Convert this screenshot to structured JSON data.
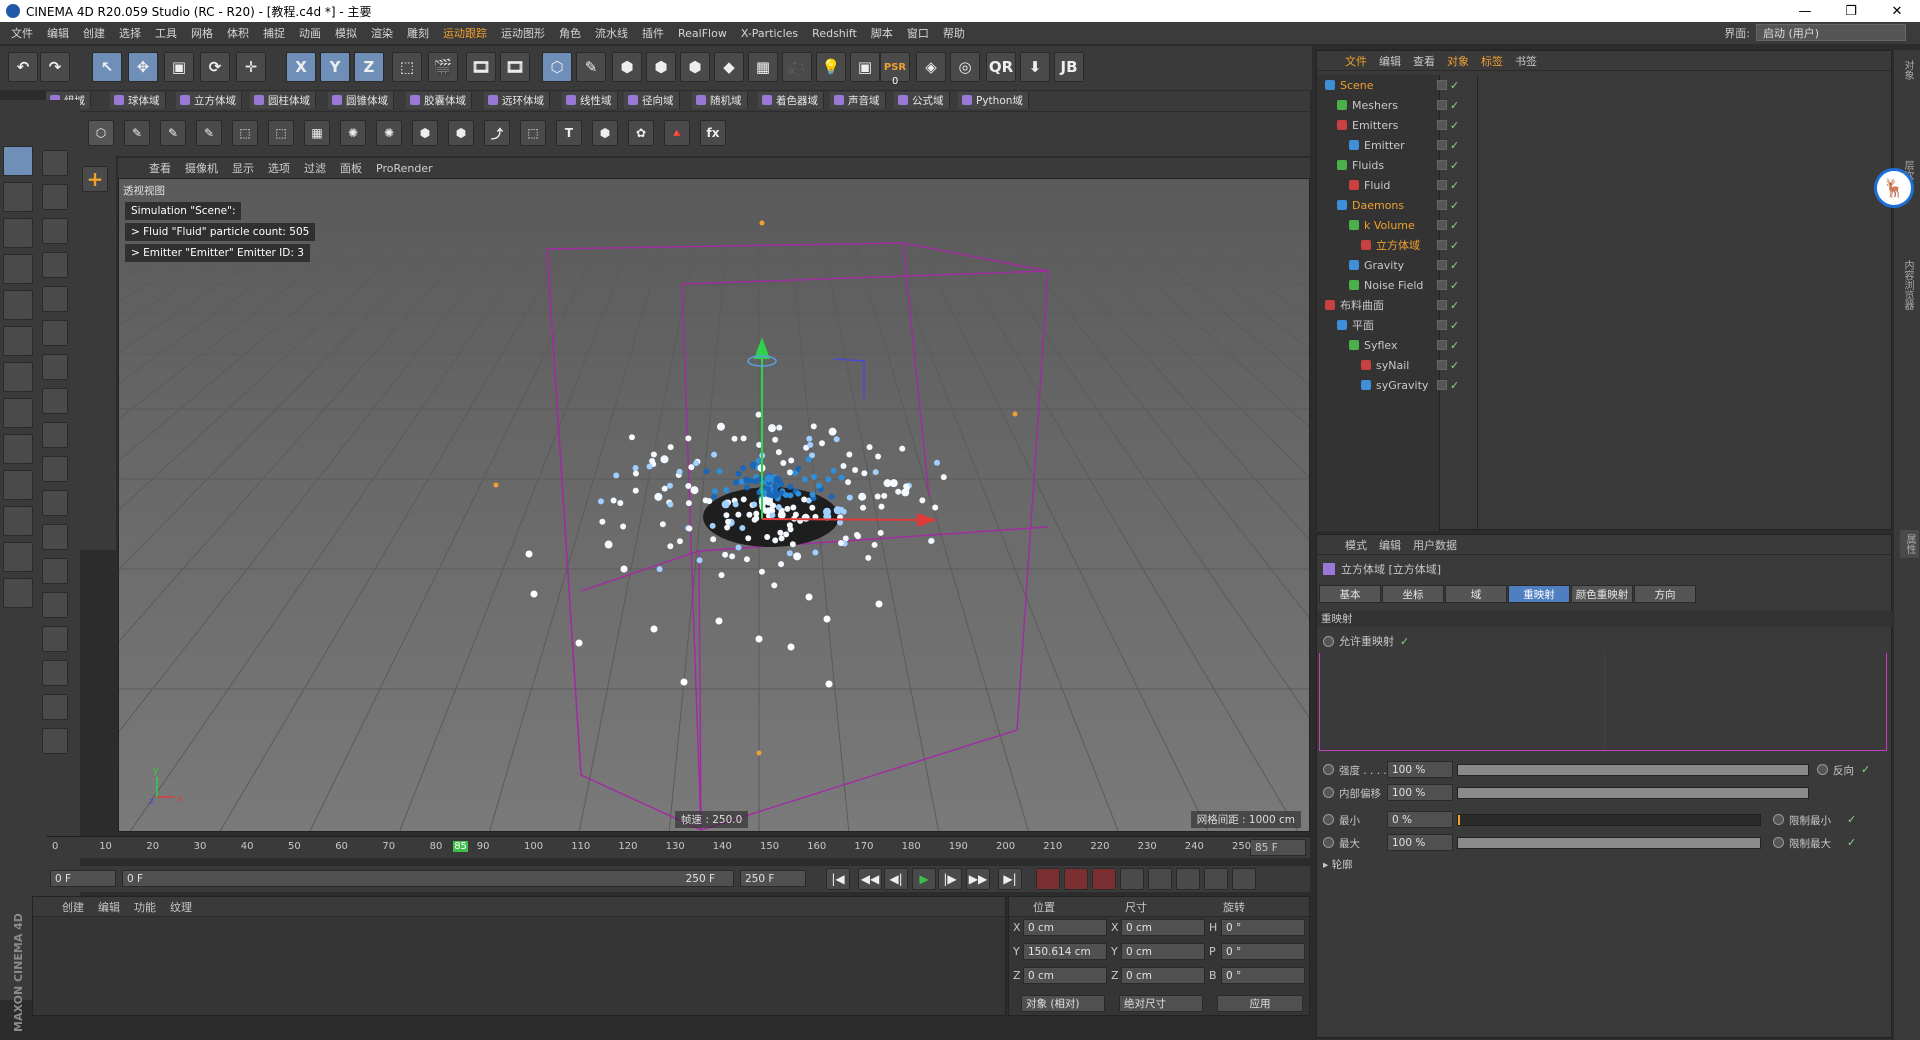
{
  "title": "CINEMA 4D R20.059 Studio (RC - R20) - [教程.c4d *] - 主要",
  "window_controls": [
    "—",
    "❐",
    "✕"
  ],
  "menu": [
    "文件",
    "编辑",
    "创建",
    "选择",
    "工具",
    "网格",
    "体积",
    "捕捉",
    "动画",
    "模拟",
    "渲染",
    "雕刻",
    "运动跟踪",
    "运动图形",
    "角色",
    "流水线",
    "插件",
    "RealFlow",
    "X-Particles",
    "Redshift",
    "脚本",
    "窗口",
    "帮助"
  ],
  "layout_label": "界面:",
  "layout_value": "启动 (用户)",
  "toolbar_main": [
    "↶",
    "↷",
    "↖",
    "✥",
    "▣",
    "⟳",
    "✛",
    "X",
    "Y",
    "Z",
    "⬚",
    "🎬",
    "🎞",
    "🎞",
    "⬡",
    "✎",
    "⬢",
    "⬢",
    "⬢",
    "◆",
    "▦",
    "🎥",
    "💡",
    "▣",
    "PSR",
    "◈",
    "◎",
    "QR",
    "⬇",
    "JB"
  ],
  "toolbar_main_icons": [
    "undo-icon",
    "redo-icon",
    "select-icon",
    "move-icon",
    "scale-icon",
    "rotate-icon",
    "transform-icon",
    "x-axis-icon",
    "y-axis-icon",
    "z-axis-icon",
    "coord-icon",
    "render-view-icon",
    "render-icon",
    "render-settings-icon",
    "cube-icon",
    "pen-icon",
    "subdivide-icon",
    "array-icon",
    "deformer-icon",
    "field-icon",
    "floor-icon",
    "camera-icon",
    "light-icon",
    "tag-icon",
    "psr-icon",
    "xpresso-icon",
    "sphere-icon",
    "qr-icon",
    "drop-icon",
    "jb-icon"
  ],
  "psr_value": "0",
  "fields_bar": [
    "组域",
    "球体域",
    "立方体域",
    "圆柱体域",
    "圆锥体域",
    "胶囊体域",
    "远环体域",
    "线性域",
    "径向域",
    "随机域",
    "着色器域",
    "声音域",
    "公式域",
    "Python域"
  ],
  "toolbar_second": [
    "▦",
    "⬡",
    "✎",
    "✎",
    "✎",
    "⬚",
    "⬚",
    "▦",
    "✺",
    "✺",
    "⬢",
    "⬢",
    "⤴",
    "⬚",
    "T",
    "⬢",
    "✿",
    "🔺",
    "fx"
  ],
  "viewport_menu": [
    "查看",
    "摄像机",
    "显示",
    "选项",
    "过滤",
    "面板",
    "ProRender"
  ],
  "viewport_label": "透视视图",
  "hud": [
    "Simulation \"Scene\":",
    "  > Fluid \"Fluid\" particle count: 505",
    "  > Emitter \"Emitter\" Emitter ID: 3"
  ],
  "fps": "帧速 : 250.0",
  "grid_spacing": "网格间距 : 1000 cm",
  "timeline_ticks": [
    "0",
    "10",
    "20",
    "30",
    "40",
    "50",
    "60",
    "70",
    "80",
    "85",
    "90",
    "100",
    "110",
    "120",
    "130",
    "140",
    "150",
    "160",
    "170",
    "180",
    "190",
    "200",
    "210",
    "220",
    "230",
    "240",
    "250"
  ],
  "current_frame": "85 F",
  "timeline_start": "0 F",
  "timeline_range_start": "0 F",
  "timeline_range_end": "250 F",
  "timeline_end": "250 F",
  "playback": [
    "|◀",
    "◀◀",
    "◀|",
    "▶",
    "|▶",
    "▶▶",
    "▶|"
  ],
  "material_menu": [
    "创建",
    "编辑",
    "功能",
    "纹理"
  ],
  "brand": "MAXON CINEMA 4D",
  "coord_headers": [
    "位置",
    "尺寸",
    "旋转"
  ],
  "coords": [
    {
      "axis": "X",
      "pos": "0 cm",
      "size_axis": "X",
      "size": "0 cm",
      "rot_axis": "H",
      "rot": "0 °"
    },
    {
      "axis": "Y",
      "pos": "150.614 cm",
      "size_axis": "Y",
      "size": "0 cm",
      "rot_axis": "P",
      "rot": "0 °"
    },
    {
      "axis": "Z",
      "pos": "0 cm",
      "size_axis": "Z",
      "size": "0 cm",
      "rot_axis": "B",
      "rot": "0 °"
    }
  ],
  "coord_mode": "对象 (相对)",
  "size_mode": "绝对尺寸",
  "apply": "应用",
  "obj_menu": [
    "文件",
    "编辑",
    "查看",
    "对象",
    "标签",
    "书签"
  ],
  "objects": [
    {
      "name": "Scene",
      "indent": 0,
      "color": "#f0a030"
    },
    {
      "name": "Meshers",
      "indent": 1,
      "color": "#c8c8c8"
    },
    {
      "name": "Emitters",
      "indent": 1,
      "color": "#c8c8c8"
    },
    {
      "name": "Emitter",
      "indent": 2,
      "color": "#c8c8c8"
    },
    {
      "name": "Fluids",
      "indent": 1,
      "color": "#c8c8c8"
    },
    {
      "name": "Fluid",
      "indent": 2,
      "color": "#c8c8c8"
    },
    {
      "name": "Daemons",
      "indent": 1,
      "color": "#f0a030"
    },
    {
      "name": "k Volume",
      "indent": 2,
      "color": "#f0a030"
    },
    {
      "name": "立方体域",
      "indent": 3,
      "color": "#f0a030"
    },
    {
      "name": "Gravity",
      "indent": 2,
      "color": "#c8c8c8"
    },
    {
      "name": "Noise Field",
      "indent": 2,
      "color": "#c8c8c8"
    },
    {
      "name": "布料曲面",
      "indent": 0,
      "color": "#c8c8c8"
    },
    {
      "name": "平面",
      "indent": 1,
      "color": "#c8c8c8"
    },
    {
      "name": "Syflex",
      "indent": 2,
      "color": "#c8c8c8"
    },
    {
      "name": "syNail",
      "indent": 3,
      "color": "#c8c8c8"
    },
    {
      "name": "syGravity",
      "indent": 3,
      "color": "#c8c8c8"
    }
  ],
  "attr_menu": [
    "模式",
    "编辑",
    "用户数据"
  ],
  "attr_title": "立方体域 [立方体域]",
  "attr_tabs": [
    "基本",
    "坐标",
    "域",
    "重映射",
    "颜色重映射",
    "方向"
  ],
  "attr_active_tab": 3,
  "section_remap": "重映射",
  "allow_remap": "允许重映射",
  "params": [
    {
      "label": "强度 . . . .",
      "value": "100 %",
      "fill": 1.0,
      "right": "反向"
    },
    {
      "label": "内部偏移",
      "value": "100 %",
      "fill": 1.0,
      "right": ""
    },
    {
      "label": "最小",
      "value": "0 %",
      "fill": 0.0,
      "right": "限制最小"
    },
    {
      "label": "最大",
      "value": "100 %",
      "fill": 1.0,
      "right": "限制最大"
    }
  ],
  "contour": "▸ 轮廓",
  "check": "✓",
  "right_strip": [
    "对象",
    "层次",
    "内容浏览器",
    "属性"
  ],
  "colors": {
    "accent": "#f0a030",
    "active_tab": "#4f7fc0",
    "box": "#a32aa3",
    "remap_border": "#c040c0"
  }
}
